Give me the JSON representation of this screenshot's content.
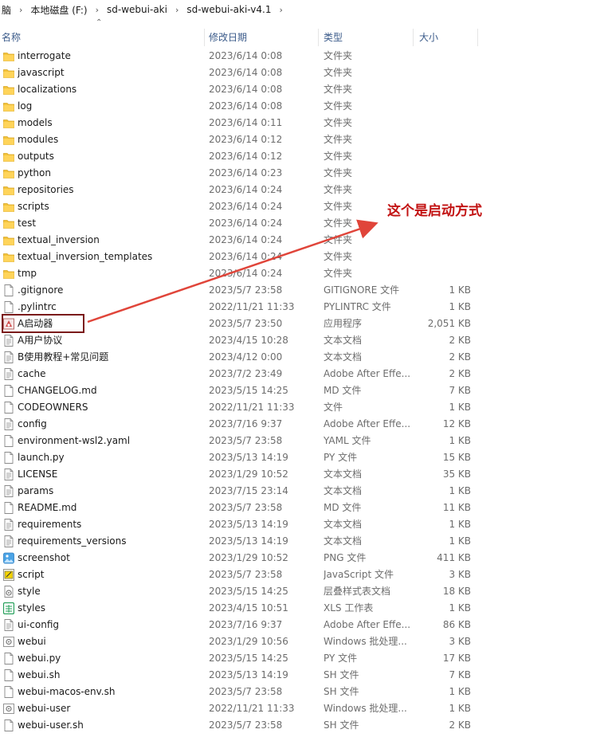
{
  "breadcrumb": {
    "items": [
      "脑",
      "本地磁盘 (F:)",
      "sd-webui-aki",
      "sd-webui-aki-v4.1"
    ]
  },
  "columns": {
    "name": "名称",
    "date": "修改日期",
    "type": "类型",
    "size": "大小"
  },
  "annotation": {
    "text": "这个是启动方式",
    "color": "#c21212"
  },
  "files": [
    {
      "name": "interrogate",
      "date": "2023/6/14 0:08",
      "type": "文件夹",
      "size": "",
      "icon": "folder-icon"
    },
    {
      "name": "javascript",
      "date": "2023/6/14 0:08",
      "type": "文件夹",
      "size": "",
      "icon": "folder-icon"
    },
    {
      "name": "localizations",
      "date": "2023/6/14 0:08",
      "type": "文件夹",
      "size": "",
      "icon": "folder-icon"
    },
    {
      "name": "log",
      "date": "2023/6/14 0:08",
      "type": "文件夹",
      "size": "",
      "icon": "folder-icon"
    },
    {
      "name": "models",
      "date": "2023/6/14 0:11",
      "type": "文件夹",
      "size": "",
      "icon": "folder-icon"
    },
    {
      "name": "modules",
      "date": "2023/6/14 0:12",
      "type": "文件夹",
      "size": "",
      "icon": "folder-icon"
    },
    {
      "name": "outputs",
      "date": "2023/6/14 0:12",
      "type": "文件夹",
      "size": "",
      "icon": "folder-icon"
    },
    {
      "name": "python",
      "date": "2023/6/14 0:23",
      "type": "文件夹",
      "size": "",
      "icon": "folder-icon"
    },
    {
      "name": "repositories",
      "date": "2023/6/14 0:24",
      "type": "文件夹",
      "size": "",
      "icon": "folder-icon"
    },
    {
      "name": "scripts",
      "date": "2023/6/14 0:24",
      "type": "文件夹",
      "size": "",
      "icon": "folder-icon"
    },
    {
      "name": "test",
      "date": "2023/6/14 0:24",
      "type": "文件夹",
      "size": "",
      "icon": "folder-icon"
    },
    {
      "name": "textual_inversion",
      "date": "2023/6/14 0:24",
      "type": "文件夹",
      "size": "",
      "icon": "folder-icon"
    },
    {
      "name": "textual_inversion_templates",
      "date": "2023/6/14 0:24",
      "type": "文件夹",
      "size": "",
      "icon": "folder-icon"
    },
    {
      "name": "tmp",
      "date": "2023/6/14 0:24",
      "type": "文件夹",
      "size": "",
      "icon": "folder-icon"
    },
    {
      "name": ".gitignore",
      "date": "2023/5/7 23:58",
      "type": "GITIGNORE 文件",
      "size": "1 KB",
      "icon": "file-icon"
    },
    {
      "name": ".pylintrc",
      "date": "2022/11/21 11:33",
      "type": "PYLINTRC 文件",
      "size": "1 KB",
      "icon": "file-icon"
    },
    {
      "name": "A启动器",
      "date": "2023/5/7 23:50",
      "type": "应用程序",
      "size": "2,051 KB",
      "icon": "app-icon"
    },
    {
      "name": "A用户协议",
      "date": "2023/4/15 10:28",
      "type": "文本文档",
      "size": "2 KB",
      "icon": "text-file-icon"
    },
    {
      "name": "B使用教程+常见问题",
      "date": "2023/4/12 0:00",
      "type": "文本文档",
      "size": "2 KB",
      "icon": "text-file-icon"
    },
    {
      "name": "cache",
      "date": "2023/7/2 23:49",
      "type": "Adobe After Effe...",
      "size": "2 KB",
      "icon": "text-file-icon"
    },
    {
      "name": "CHANGELOG.md",
      "date": "2023/5/15 14:25",
      "type": "MD 文件",
      "size": "7 KB",
      "icon": "file-icon"
    },
    {
      "name": "CODEOWNERS",
      "date": "2022/11/21 11:33",
      "type": "文件",
      "size": "1 KB",
      "icon": "file-icon"
    },
    {
      "name": "config",
      "date": "2023/7/16 9:37",
      "type": "Adobe After Effe...",
      "size": "12 KB",
      "icon": "text-file-icon"
    },
    {
      "name": "environment-wsl2.yaml",
      "date": "2023/5/7 23:58",
      "type": "YAML 文件",
      "size": "1 KB",
      "icon": "file-icon"
    },
    {
      "name": "launch.py",
      "date": "2023/5/13 14:19",
      "type": "PY 文件",
      "size": "15 KB",
      "icon": "file-icon"
    },
    {
      "name": "LICENSE",
      "date": "2023/1/29 10:52",
      "type": "文本文档",
      "size": "35 KB",
      "icon": "text-file-icon"
    },
    {
      "name": "params",
      "date": "2023/7/15 23:14",
      "type": "文本文档",
      "size": "1 KB",
      "icon": "text-file-icon"
    },
    {
      "name": "README.md",
      "date": "2023/5/7 23:58",
      "type": "MD 文件",
      "size": "11 KB",
      "icon": "file-icon"
    },
    {
      "name": "requirements",
      "date": "2023/5/13 14:19",
      "type": "文本文档",
      "size": "1 KB",
      "icon": "text-file-icon"
    },
    {
      "name": "requirements_versions",
      "date": "2023/5/13 14:19",
      "type": "文本文档",
      "size": "1 KB",
      "icon": "text-file-icon"
    },
    {
      "name": "screenshot",
      "date": "2023/1/29 10:52",
      "type": "PNG 文件",
      "size": "411 KB",
      "icon": "image-file-icon"
    },
    {
      "name": "script",
      "date": "2023/5/7 23:58",
      "type": "JavaScript 文件",
      "size": "3 KB",
      "icon": "js-file-icon"
    },
    {
      "name": "style",
      "date": "2023/5/15 14:25",
      "type": "层叠样式表文档",
      "size": "18 KB",
      "icon": "css-file-icon"
    },
    {
      "name": "styles",
      "date": "2023/4/15 10:51",
      "type": "XLS 工作表",
      "size": "1 KB",
      "icon": "spreadsheet-icon"
    },
    {
      "name": "ui-config",
      "date": "2023/7/16 9:37",
      "type": "Adobe After Effe...",
      "size": "86 KB",
      "icon": "text-file-icon"
    },
    {
      "name": "webui",
      "date": "2023/1/29 10:56",
      "type": "Windows 批处理...",
      "size": "3 KB",
      "icon": "batch-file-icon"
    },
    {
      "name": "webui.py",
      "date": "2023/5/15 14:25",
      "type": "PY 文件",
      "size": "17 KB",
      "icon": "file-icon"
    },
    {
      "name": "webui.sh",
      "date": "2023/5/13 14:19",
      "type": "SH 文件",
      "size": "7 KB",
      "icon": "file-icon"
    },
    {
      "name": "webui-macos-env.sh",
      "date": "2023/5/7 23:58",
      "type": "SH 文件",
      "size": "1 KB",
      "icon": "file-icon"
    },
    {
      "name": "webui-user",
      "date": "2022/11/21 11:33",
      "type": "Windows 批处理...",
      "size": "1 KB",
      "icon": "batch-file-icon"
    },
    {
      "name": "webui-user.sh",
      "date": "2023/5/7 23:58",
      "type": "SH 文件",
      "size": "2 KB",
      "icon": "file-icon"
    }
  ]
}
